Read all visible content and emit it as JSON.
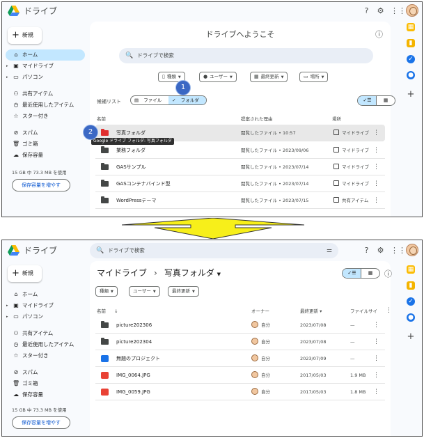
{
  "step1": {
    "app_title": "ドライブ",
    "new_label": "新規",
    "nav": [
      {
        "label": "ホーム"
      },
      {
        "label": "マイドライブ"
      },
      {
        "label": "パソコン"
      },
      {
        "label": "共有アイテム"
      },
      {
        "label": "最近使用したアイテム"
      },
      {
        "label": "スター付き"
      },
      {
        "label": "スパム"
      },
      {
        "label": "ゴミ箱"
      },
      {
        "label": "保存容量"
      }
    ],
    "storage_text": "15 GB 中 73.3 MB を使用",
    "storage_button": "保存容量を増やす",
    "welcome": "ドライブへようこそ",
    "search_placeholder": "ドライブで検索",
    "filters": {
      "type": "種類",
      "people": "ユーザー",
      "modified": "最終更新",
      "location": "場所"
    },
    "suggest_label": "候補リスト",
    "suggest_file": "ファイル",
    "suggest_folder": "フォルダ",
    "headers": {
      "name": "名前",
      "reason": "提案された理由",
      "location": "場所"
    },
    "rows": [
      {
        "name": "写真フォルダ",
        "reason": "閲覧したファイル • 10:57",
        "location": "マイドライブ"
      },
      {
        "name": "業務フォルダ",
        "reason": "閲覧したファイル • 2023/09/06",
        "location": "マイドライブ"
      },
      {
        "name": "GASサンプル",
        "reason": "閲覧したファイル • 2023/07/14",
        "location": "マイドライブ"
      },
      {
        "name": "GASコンテナバインド型",
        "reason": "閲覧したファイル • 2023/07/14",
        "location": "マイドライブ"
      },
      {
        "name": "WordPressテーマ",
        "reason": "閲覧したファイル • 2023/07/15",
        "location": "共有アイテム"
      }
    ],
    "tooltip": "Google ドライブ フォルダ: 写真フォルダ",
    "badge1": "1",
    "badge2": "2"
  },
  "step2": {
    "app_title": "ドライブ",
    "search_placeholder": "ドライブで検索",
    "new_label": "新規",
    "nav": [
      {
        "label": "ホーム"
      },
      {
        "label": "マイドライブ"
      },
      {
        "label": "パソコン"
      },
      {
        "label": "共有アイテム"
      },
      {
        "label": "最近使用したアイテム"
      },
      {
        "label": "スター付き"
      },
      {
        "label": "スパム"
      },
      {
        "label": "ゴミ箱"
      },
      {
        "label": "保存容量"
      }
    ],
    "storage_text": "15 GB 中 73.3 MB を使用",
    "storage_button": "保存容量を増やす",
    "breadcrumb_root": "マイドライブ",
    "breadcrumb_current": "写真フォルダ",
    "filters": {
      "type": "種類",
      "people": "ユーザー",
      "modified": "最終更新"
    },
    "headers": {
      "name": "名前",
      "owner": "オーナー",
      "modified": "最終更新",
      "size": "ファイルサイ"
    },
    "rows": [
      {
        "name": "picture202306",
        "owner": "自分",
        "modified": "2023/07/08",
        "size": "—",
        "icon": "folder"
      },
      {
        "name": "picture202304",
        "owner": "自分",
        "modified": "2023/07/08",
        "size": "—",
        "icon": "folder"
      },
      {
        "name": "無題のプロジェクト",
        "owner": "自分",
        "modified": "2023/07/09",
        "size": "—",
        "icon": "script"
      },
      {
        "name": "IMG_0064.JPG",
        "owner": "自分",
        "modified": "2017/05/03",
        "size": "1.9 MB",
        "icon": "image"
      },
      {
        "name": "IMG_0059.JPG",
        "owner": "自分",
        "modified": "2017/05/03",
        "size": "1.8 MB",
        "icon": "image"
      }
    ]
  },
  "colors": {
    "accent": "#c2e7ff",
    "badge": "#3b68c4",
    "arrow": "#f7ef1a",
    "folder_red": "#e12f2f"
  }
}
